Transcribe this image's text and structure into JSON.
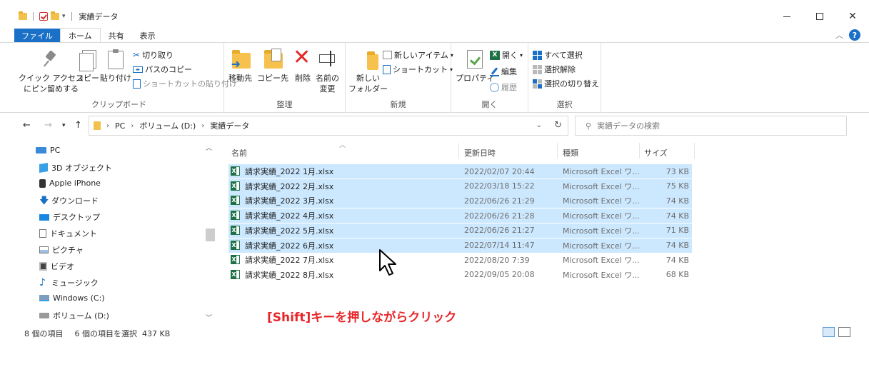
{
  "window": {
    "title": "実績データ",
    "controls": {
      "minimize": "—",
      "maximize": "☐",
      "close": "✕"
    }
  },
  "ribbon_tabs": [
    "ファイル",
    "ホーム",
    "共有",
    "表示"
  ],
  "ribbon": {
    "clipboard": {
      "label": "クリップボード",
      "pin_line1": "クイック アクセス",
      "pin_line2": "にピン留めする",
      "copy": "コピー",
      "paste": "貼り付け",
      "cut": "切り取り",
      "copy_path": "パスのコピー",
      "paste_shortcut": "ショートカットの貼り付け"
    },
    "organize": {
      "label": "整理",
      "move_to": "移動先",
      "copy_to": "コピー先",
      "delete": "削除",
      "rename_line1": "名前の",
      "rename_line2": "変更"
    },
    "new": {
      "label": "新規",
      "new_folder_line1": "新しい",
      "new_folder_line2": "フォルダー",
      "new_item": "新しいアイテム",
      "easy_access": "ショートカット"
    },
    "open": {
      "label": "開く",
      "properties": "プロパティ",
      "open": "開く",
      "edit": "編集",
      "history": "履歴"
    },
    "select": {
      "label": "選択",
      "select_all": "すべて選択",
      "select_none": "選択解除",
      "invert": "選択の切り替え"
    }
  },
  "address": {
    "crumbs": [
      "PC",
      "ボリューム (D:)",
      "実績データ"
    ],
    "search_placeholder": "実績データの検索"
  },
  "nav": {
    "items": [
      "PC",
      "3D オブジェクト",
      "Apple iPhone",
      "ダウンロード",
      "デスクトップ",
      "ドキュメント",
      "ピクチャ",
      "ビデオ",
      "ミュージック",
      "Windows (C:)",
      "ボリューム (D:)"
    ]
  },
  "columns": {
    "name": "名前",
    "date": "更新日時",
    "type": "種類",
    "size": "サイズ"
  },
  "files": [
    {
      "name": "請求実績_2022 1月.xlsx",
      "date": "2022/02/07 20:44",
      "type": "Microsoft Excel ワ...",
      "size": "73 KB",
      "selected": true
    },
    {
      "name": "請求実績_2022 2月.xlsx",
      "date": "2022/03/18 15:22",
      "type": "Microsoft Excel ワ...",
      "size": "75 KB",
      "selected": true
    },
    {
      "name": "請求実績_2022 3月.xlsx",
      "date": "2022/06/26 21:29",
      "type": "Microsoft Excel ワ...",
      "size": "74 KB",
      "selected": true
    },
    {
      "name": "請求実績_2022 4月.xlsx",
      "date": "2022/06/26 21:28",
      "type": "Microsoft Excel ワ...",
      "size": "74 KB",
      "selected": true
    },
    {
      "name": "請求実績_2022 5月.xlsx",
      "date": "2022/06/26 21:27",
      "type": "Microsoft Excel ワ...",
      "size": "71 KB",
      "selected": true
    },
    {
      "name": "請求実績_2022 6月.xlsx",
      "date": "2022/07/14 11:47",
      "type": "Microsoft Excel ワ...",
      "size": "74 KB",
      "selected": true
    },
    {
      "name": "請求実績_2022 7月.xlsx",
      "date": "2022/08/20 7:39",
      "type": "Microsoft Excel ワ...",
      "size": "74 KB",
      "selected": false
    },
    {
      "name": "請求実績_2022 8月.xlsx",
      "date": "2022/09/05 20:08",
      "type": "Microsoft Excel ワ...",
      "size": "68 KB",
      "selected": false
    }
  ],
  "annotation": "[Shift]キーを押しながらクリック",
  "status": {
    "count": "8 個の項目",
    "selected": "6 個の項目を選択",
    "size": "437 KB"
  },
  "colors": {
    "accent": "#1a6fc6",
    "selection": "#cce8ff",
    "annotation": "#e8262a",
    "excel": "#1e7145"
  }
}
